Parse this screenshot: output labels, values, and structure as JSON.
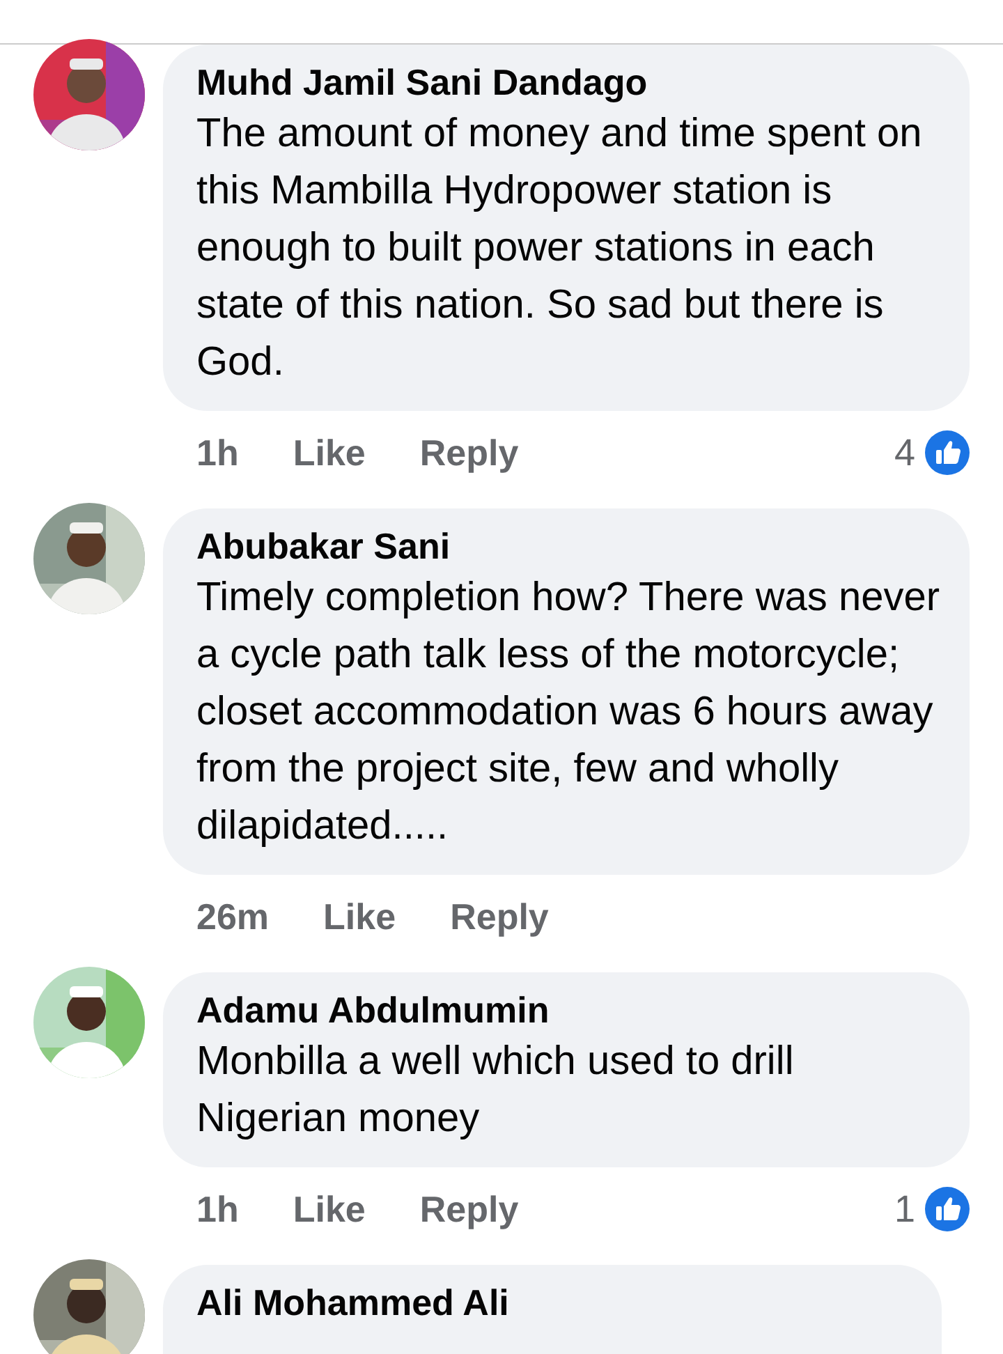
{
  "comments": [
    {
      "author": "Muhd Jamil Sani Dandago",
      "text": "The amount of money and time spent on this Mambilla Hydropower station is enough to built power stations in each state of this nation. So sad but there is God.",
      "time": "1h",
      "like": "Like",
      "reply": "Reply",
      "reaction_count": "4"
    },
    {
      "author": "Abubakar Sani",
      "text": "Timely completion how? There was never a cycle path talk less of the motorcycle; closet accommodation was 6 hours away from the project site, few and wholly dilapidated.....",
      "time": "26m",
      "like": "Like",
      "reply": "Reply"
    },
    {
      "author": "Adamu Abdulmumin",
      "text": "Monbilla a well which used to drill Nigerian money",
      "time": "1h",
      "like": "Like",
      "reply": "Reply",
      "reaction_count": "1"
    },
    {
      "author": "Ali Mohammed Ali"
    }
  ]
}
